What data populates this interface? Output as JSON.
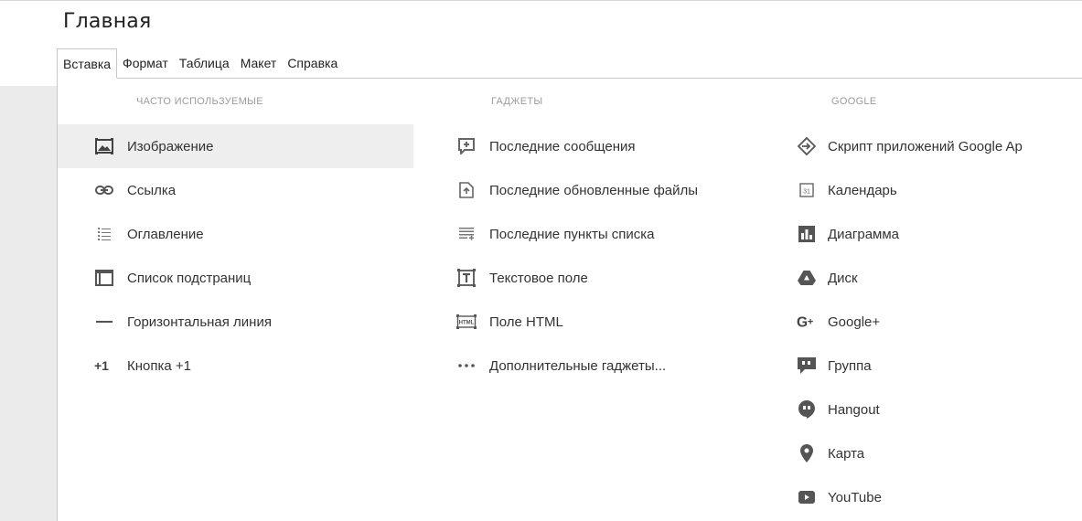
{
  "page": {
    "title": "Главная"
  },
  "menubar": {
    "items": [
      {
        "label": "Вставка",
        "active": true
      },
      {
        "label": "Формат"
      },
      {
        "label": "Таблица"
      },
      {
        "label": "Макет"
      },
      {
        "label": "Справка"
      }
    ]
  },
  "dropdown": {
    "columns": [
      {
        "header": "ЧАСТО ИСПОЛЬЗУЕМЫЕ",
        "items": [
          {
            "label": "Изображение",
            "icon": "image-icon",
            "highlighted": true
          },
          {
            "label": "Ссылка",
            "icon": "link-icon"
          },
          {
            "label": "Оглавление",
            "icon": "table-of-contents-icon"
          },
          {
            "label": "Список подстраниц",
            "icon": "subpages-icon"
          },
          {
            "label": "Горизонтальная линия",
            "icon": "horizontal-line-icon"
          },
          {
            "label": "Кнопка +1",
            "icon": "plus-one-icon"
          }
        ]
      },
      {
        "header": "ГАДЖЕТЫ",
        "items": [
          {
            "label": "Последние сообщения",
            "icon": "recent-posts-icon"
          },
          {
            "label": "Последние обновленные файлы",
            "icon": "recent-files-icon"
          },
          {
            "label": "Последние пункты списка",
            "icon": "recent-list-items-icon"
          },
          {
            "label": "Текстовое поле",
            "icon": "text-box-icon"
          },
          {
            "label": "Поле HTML",
            "icon": "html-box-icon"
          },
          {
            "label": "Дополнительные гаджеты...",
            "icon": "more-dots-icon"
          }
        ]
      },
      {
        "header": "GOOGLE",
        "items": [
          {
            "label": "Скрипт приложений Google Ap",
            "icon": "apps-script-icon"
          },
          {
            "label": "Календарь",
            "icon": "calendar-icon"
          },
          {
            "label": "Диаграмма",
            "icon": "chart-icon"
          },
          {
            "label": "Диск",
            "icon": "drive-icon"
          },
          {
            "label": "Google+",
            "icon": "google-plus-icon"
          },
          {
            "label": "Группа",
            "icon": "groups-icon"
          },
          {
            "label": "Hangout",
            "icon": "hangouts-icon"
          },
          {
            "label": "Карта",
            "icon": "map-pin-icon"
          },
          {
            "label": "YouTube",
            "icon": "youtube-icon"
          }
        ]
      }
    ]
  },
  "colors": {
    "icon": "#616161",
    "highlight": "#eeeeee",
    "header": "#9b9b9b"
  }
}
